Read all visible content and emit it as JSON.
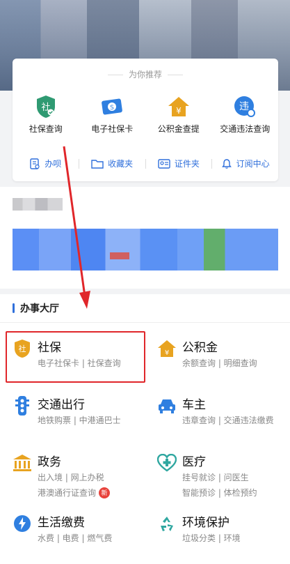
{
  "recommend": {
    "title": "为你推荐",
    "items": [
      {
        "label": "社保查询",
        "icon": "shield-she-icon"
      },
      {
        "label": "电子社保卡",
        "icon": "card-icon"
      },
      {
        "label": "公积金查提",
        "icon": "house-yuan-icon"
      },
      {
        "label": "交通违法查询",
        "icon": "traffic-violation-icon"
      }
    ],
    "tools": [
      {
        "label": "办呗",
        "icon": "document-icon"
      },
      {
        "label": "收藏夹",
        "icon": "folder-icon"
      },
      {
        "label": "证件夹",
        "icon": "id-card-icon"
      },
      {
        "label": "订阅中心",
        "icon": "bell-icon"
      }
    ]
  },
  "hall": {
    "title": "办事大厅",
    "services": [
      {
        "title": "社保",
        "sub": "电子社保卡 | 社保查询",
        "icon": "shield-she-icon"
      },
      {
        "title": "公积金",
        "sub": "余额查询 | 明细查询",
        "icon": "house-yuan-icon"
      },
      {
        "title": "交通出行",
        "sub": "地铁购票 | 中港通巴士",
        "icon": "traffic-light-icon"
      },
      {
        "title": "车主",
        "sub": "违章查询 | 交通违法缴费",
        "icon": "car-icon"
      },
      {
        "title": "政务",
        "sub": "出入境 | 网上办税",
        "sub2": "港澳通行证查询",
        "badge": "新",
        "icon": "government-building-icon"
      },
      {
        "title": "医疗",
        "sub": "挂号就诊 | 问医生",
        "sub2": "智能预诊 | 体检预约",
        "icon": "medical-heart-icon"
      },
      {
        "title": "生活缴费",
        "sub": "水费 | 电费 | 燃气费",
        "icon": "lightning-icon"
      },
      {
        "title": "环境保护",
        "sub": "垃圾分类 | 环境",
        "icon": "recycle-icon"
      }
    ]
  },
  "colors": {
    "accent": "#2f6fdb",
    "highlight": "#e0262a",
    "green": "#2f9a72",
    "orange": "#e8a320"
  }
}
